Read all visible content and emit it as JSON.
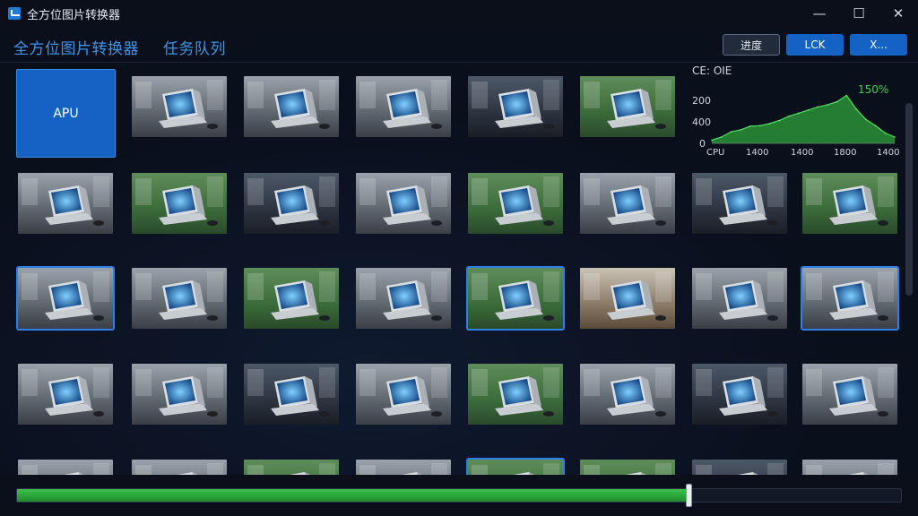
{
  "window": {
    "title": "全方位图片转换器",
    "controls": {
      "minimize": "—",
      "maximize": "☐",
      "close": "✕"
    }
  },
  "header": {
    "tabs": [
      {
        "label": "全方位图片转换器"
      },
      {
        "label": "任务队列"
      }
    ],
    "buttons": {
      "progress": "进度",
      "lock": "LCK",
      "extra": "X..."
    }
  },
  "grid": {
    "apu_tile_label": "APU",
    "thumbnails": [
      {
        "scene": "indoor",
        "selected": false
      },
      {
        "scene": "indoor",
        "selected": false
      },
      {
        "scene": "indoor",
        "selected": false
      },
      {
        "scene": "dark",
        "selected": false
      },
      {
        "scene": "forest",
        "selected": false
      },
      {
        "scene": "indoor",
        "selected": false
      },
      {
        "scene": "forest",
        "selected": false
      },
      {
        "scene": "dark",
        "selected": false
      },
      {
        "scene": "indoor",
        "selected": false
      },
      {
        "scene": "forest",
        "selected": false
      },
      {
        "scene": "indoor",
        "selected": false
      },
      {
        "scene": "dark",
        "selected": false
      },
      {
        "scene": "forest",
        "selected": false
      },
      {
        "scene": "indoor",
        "selected": true
      },
      {
        "scene": "indoor",
        "selected": false
      },
      {
        "scene": "forest",
        "selected": false
      },
      {
        "scene": "indoor",
        "selected": false
      },
      {
        "scene": "forest",
        "selected": true
      },
      {
        "scene": "desk",
        "selected": false
      },
      {
        "scene": "indoor",
        "selected": false
      },
      {
        "scene": "indoor",
        "selected": true
      },
      {
        "scene": "indoor",
        "selected": false
      },
      {
        "scene": "indoor",
        "selected": false
      },
      {
        "scene": "dark",
        "selected": false
      },
      {
        "scene": "indoor",
        "selected": false
      },
      {
        "scene": "forest",
        "selected": false
      },
      {
        "scene": "indoor",
        "selected": false
      },
      {
        "scene": "dark",
        "selected": false
      },
      {
        "scene": "indoor",
        "selected": false
      },
      {
        "scene": "indoor",
        "selected": false
      },
      {
        "scene": "indoor",
        "selected": false
      },
      {
        "scene": "forest",
        "selected": false
      },
      {
        "scene": "indoor",
        "selected": false
      },
      {
        "scene": "forest",
        "selected": true
      },
      {
        "scene": "forest",
        "selected": false
      },
      {
        "scene": "dark",
        "selected": false
      },
      {
        "scene": "indoor",
        "selected": false
      }
    ]
  },
  "mini_chart": {
    "title": "CE: OIE",
    "y_ticks": [
      "200",
      "400",
      "0"
    ],
    "x_ticks": [
      "CPU",
      "1400",
      "1400",
      "1800",
      "1400"
    ],
    "peak_label": "150%",
    "values": [
      0.06,
      0.12,
      0.22,
      0.26,
      0.33,
      0.34,
      0.38,
      0.44,
      0.52,
      0.58,
      0.64,
      0.7,
      0.74,
      0.8,
      0.92,
      0.66,
      0.46,
      0.34,
      0.2,
      0.12
    ],
    "color": "#2fa33a"
  },
  "progress": {
    "fraction": 0.76,
    "color": "#2db53b"
  },
  "colors": {
    "accent": "#1462c4",
    "tab_text": "#3e95ea",
    "background": "#0a0f1c"
  }
}
